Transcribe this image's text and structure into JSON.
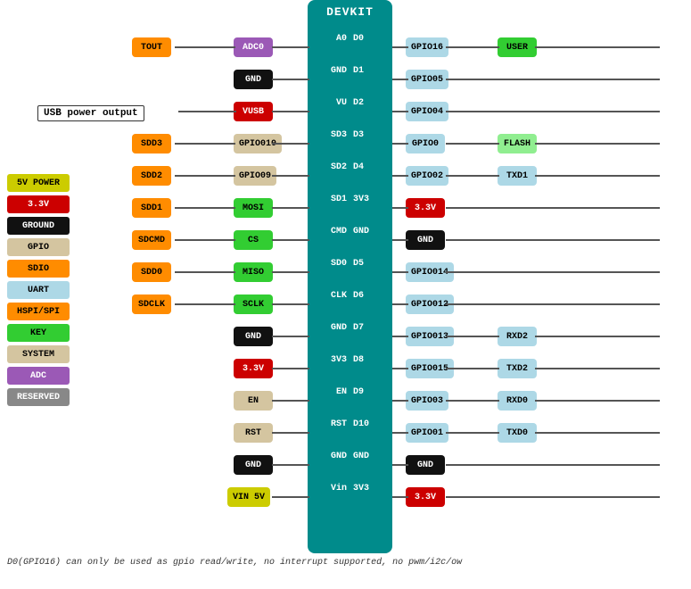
{
  "title": "DEVKIT",
  "footer": "D0(GPIO16) can only be used as gpio read/write, no interrupt supported, no pwm/i2c/ow",
  "usb_label": "USB power output",
  "legend": [
    {
      "label": "5V POWER",
      "color": "bg-yellow-g"
    },
    {
      "label": "3.3V",
      "color": "bg-red"
    },
    {
      "label": "GROUND",
      "color": "bg-black"
    },
    {
      "label": "GPIO",
      "color": "bg-tan"
    },
    {
      "label": "SDIO",
      "color": "bg-orange"
    },
    {
      "label": "UART",
      "color": "bg-lt-blue"
    },
    {
      "label": "HSPI/SPI",
      "color": "bg-orange"
    },
    {
      "label": "KEY",
      "color": "bg-lime"
    },
    {
      "label": "SYSTEM",
      "color": "bg-tan"
    },
    {
      "label": "ADC",
      "color": "bg-purple"
    },
    {
      "label": "RESERVED",
      "color": "bg-gray"
    }
  ],
  "pins_left": [
    {
      "left": "TOUT",
      "right": "ADC0",
      "pin_l": "A0",
      "pin_r": "D0"
    },
    {
      "left": "",
      "right": "GND",
      "pin_l": "GND",
      "pin_r": "D1"
    },
    {
      "left": "",
      "right": "VUSB",
      "pin_l": "VU",
      "pin_r": "D2"
    },
    {
      "left": "SDD3",
      "right": "GPIO010",
      "pin_l": "SD3",
      "pin_r": "D3"
    },
    {
      "left": "SDD2",
      "right": "GPIO09",
      "pin_l": "SD2",
      "pin_r": "D4"
    },
    {
      "left": "SDD1",
      "right": "MOSI",
      "pin_l": "SD1",
      "pin_r": "3V3"
    },
    {
      "left": "SDCMD",
      "right": "CS",
      "pin_l": "CMD",
      "pin_r": "GND"
    },
    {
      "left": "SDD0",
      "right": "MISO",
      "pin_l": "SD0",
      "pin_r": "D5"
    },
    {
      "left": "SDCLK",
      "right": "SCLK",
      "pin_l": "CLK",
      "pin_r": "D6"
    },
    {
      "left": "",
      "right": "GND",
      "pin_l": "GND",
      "pin_r": "D7"
    },
    {
      "left": "",
      "right": "3.3V",
      "pin_l": "3V3",
      "pin_r": "D8"
    },
    {
      "left": "",
      "right": "EN",
      "pin_l": "EN",
      "pin_r": "D9"
    },
    {
      "left": "",
      "right": "RST",
      "pin_l": "RST",
      "pin_r": "D10"
    },
    {
      "left": "",
      "right": "GND",
      "pin_l": "GND",
      "pin_r": "GND"
    },
    {
      "left": "",
      "right": "VIN 5V",
      "pin_l": "Vin",
      "pin_r": "3V3"
    }
  ],
  "right_chips": [
    {
      "label": "GPIO16",
      "color": "bg-lt-blue",
      "extra": "USER",
      "extra_color": "bg-lime"
    },
    {
      "label": "GPIO05",
      "color": "bg-lt-blue",
      "extra": "",
      "extra_color": ""
    },
    {
      "label": "GPIO04",
      "color": "bg-lt-blue",
      "extra": "",
      "extra_color": ""
    },
    {
      "label": "GPIO0",
      "color": "bg-lt-blue",
      "extra": "FLASH",
      "extra_color": "bg-lt-green"
    },
    {
      "label": "GPIO02",
      "color": "bg-lt-blue",
      "extra": "TXD1",
      "extra_color": "bg-lt-blue"
    },
    {
      "label": "3.3V",
      "color": "bg-red",
      "extra": "",
      "extra_color": ""
    },
    {
      "label": "GND",
      "color": "bg-black",
      "extra": "",
      "extra_color": ""
    },
    {
      "label": "GPIO014",
      "color": "bg-lt-blue",
      "extra": "",
      "extra_color": ""
    },
    {
      "label": "GPIO012",
      "color": "bg-lt-blue",
      "extra": "",
      "extra_color": ""
    },
    {
      "label": "GPIO013",
      "color": "bg-lt-blue",
      "extra": "RXD2",
      "extra_color": "bg-lt-blue"
    },
    {
      "label": "GPIO015",
      "color": "bg-lt-blue",
      "extra": "TXD2",
      "extra_color": "bg-lt-blue"
    },
    {
      "label": "GPIO03",
      "color": "bg-lt-blue",
      "extra": "RXD0",
      "extra_color": "bg-lt-blue"
    },
    {
      "label": "GPIO01",
      "color": "bg-lt-blue",
      "extra": "TXD0",
      "extra_color": "bg-lt-blue"
    },
    {
      "label": "GND",
      "color": "bg-black",
      "extra": "",
      "extra_color": ""
    },
    {
      "label": "3.3V",
      "color": "bg-red",
      "extra": "",
      "extra_color": ""
    }
  ]
}
